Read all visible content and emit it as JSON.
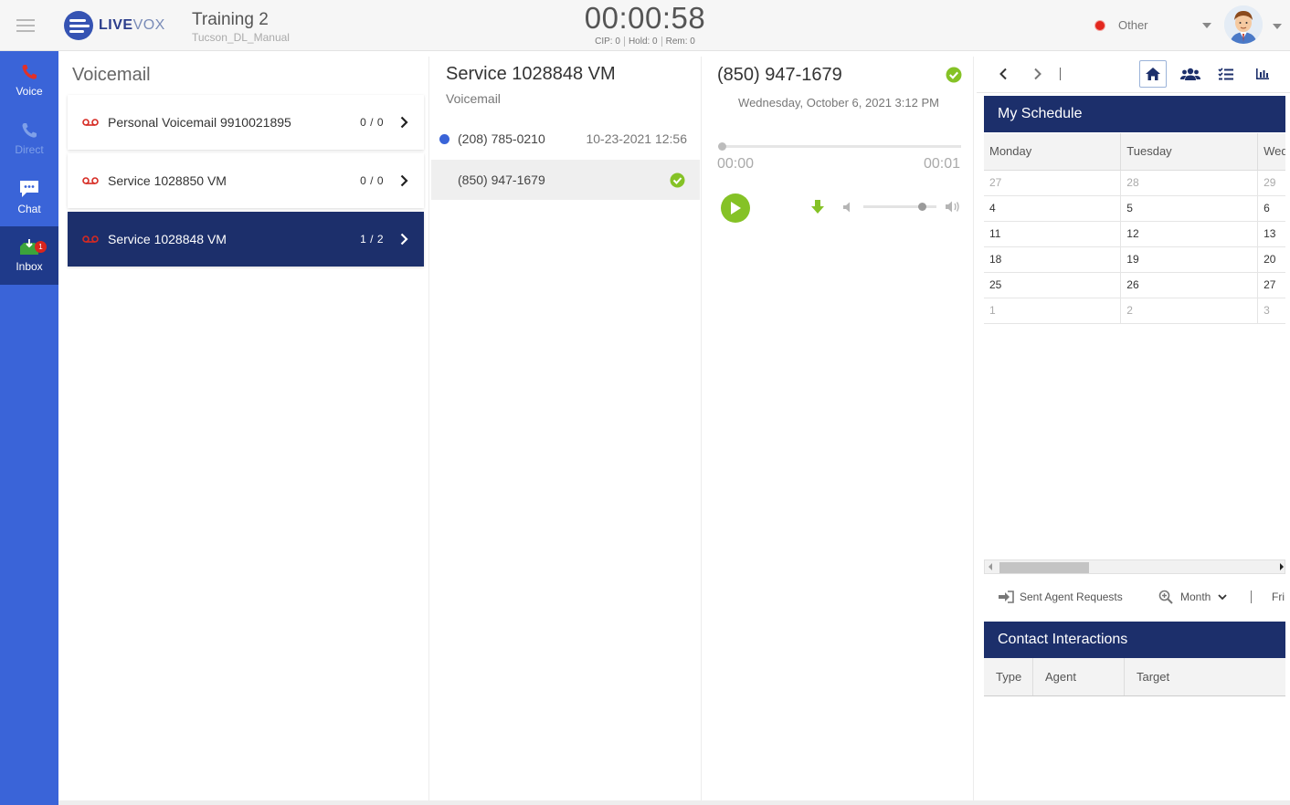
{
  "header": {
    "logo_text_a": "LIVE",
    "logo_text_b": "VOX",
    "campaign_name": "Training 2",
    "campaign_sub": "Tucson_DL_Manual",
    "timer": "00:00:58",
    "cip": "CIP: 0",
    "hold": "Hold: 0",
    "rem": "Rem: 0",
    "status_label": "Other",
    "status_color": "#e3271e"
  },
  "nav": {
    "voice": "Voice",
    "direct": "Direct",
    "chat": "Chat",
    "inbox": "Inbox",
    "inbox_badge": "1"
  },
  "voicemail": {
    "title": "Voicemail",
    "items": [
      {
        "label": "Personal Voicemail 9910021895",
        "count": "0 / 0"
      },
      {
        "label": "Service 1028850 VM",
        "count": "0 / 0"
      },
      {
        "label": "Service 1028848 VM",
        "count": "1 / 2"
      }
    ]
  },
  "messages": {
    "title": "Service 1028848 VM",
    "subtitle": "Voicemail",
    "rows": [
      {
        "number": "(208) 785-0210",
        "date": "10-23-2021 12:56"
      },
      {
        "number": "(850) 947-1679",
        "date": ""
      }
    ]
  },
  "player": {
    "number": "(850) 947-1679",
    "date": "Wednesday, October 6, 2021 3:12 PM",
    "time_start": "00:00",
    "time_end": "00:01",
    "progress_fraction": 0,
    "volume_fraction": 0.8
  },
  "schedule": {
    "title": "My Schedule",
    "days": [
      "Monday",
      "Tuesday",
      "Wed"
    ],
    "weeks": [
      [
        {
          "d": "27",
          "m": true
        },
        {
          "d": "28",
          "m": true
        },
        {
          "d": "29",
          "m": true
        }
      ],
      [
        {
          "d": "4",
          "m": false
        },
        {
          "d": "5",
          "m": false
        },
        {
          "d": "6",
          "m": false
        }
      ],
      [
        {
          "d": "11",
          "m": false
        },
        {
          "d": "12",
          "m": false
        },
        {
          "d": "13",
          "m": false
        }
      ],
      [
        {
          "d": "18",
          "m": false
        },
        {
          "d": "19",
          "m": false
        },
        {
          "d": "20",
          "m": false
        }
      ],
      [
        {
          "d": "25",
          "m": false
        },
        {
          "d": "26",
          "m": false
        },
        {
          "d": "27",
          "m": false
        }
      ],
      [
        {
          "d": "1",
          "m": true
        },
        {
          "d": "2",
          "m": true
        },
        {
          "d": "3",
          "m": true
        }
      ]
    ],
    "sent_requests": "Sent Agent Requests",
    "view": "Month",
    "fri": "Fri"
  },
  "contacts": {
    "title": "Contact Interactions",
    "columns": [
      "Type",
      "Agent",
      "Target"
    ]
  },
  "colors": {
    "nav_blue": "#3a64d8",
    "navy": "#1c2f6b",
    "green": "#85c226",
    "red": "#d9251c"
  }
}
